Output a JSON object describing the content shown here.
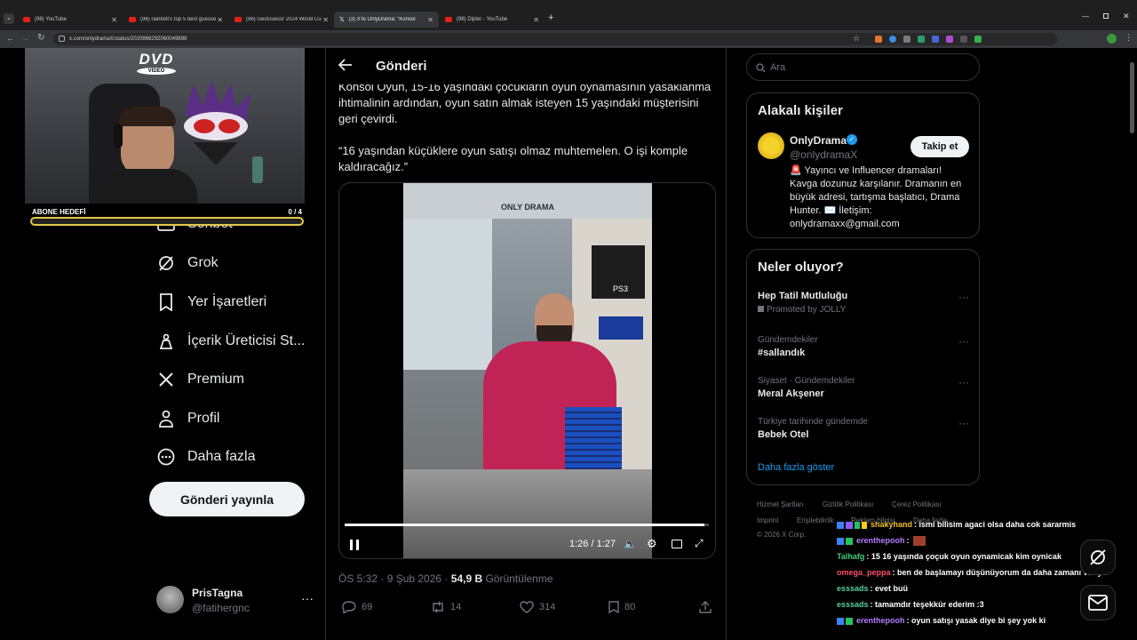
{
  "browser": {
    "tabs": [
      {
        "title": "(96) YouTube"
      },
      {
        "title": "(96) rainbolt's top 5 best guesse"
      },
      {
        "title": "(96) GeoGuessr 2024 World Cu"
      },
      {
        "title": "(3) X'te OnlyDrama: \"Konsol"
      },
      {
        "title": "(96) Dipter - YouTube"
      }
    ],
    "url": "x.com/onlydramaX/status/2020868292060049898"
  },
  "overlay": {
    "dvd_logo": "DVD",
    "dvd_sub": "VIDEO",
    "goal_label": "ABONE HEDEFİ",
    "goal_count": "0 / 4",
    "goal_progress": 0
  },
  "nav": {
    "items": [
      {
        "label": "Sohbet",
        "icon": "envelope-icon"
      },
      {
        "label": "Grok",
        "icon": "grok-icon"
      },
      {
        "label": "Yer İşaretleri",
        "icon": "bookmark-icon"
      },
      {
        "label": "İçerik Üreticisi St...",
        "icon": "creator-studio-icon"
      },
      {
        "label": "Premium",
        "icon": "x-logo-icon"
      },
      {
        "label": "Profil",
        "icon": "person-icon"
      },
      {
        "label": "Daha fazla",
        "icon": "more-circle-icon"
      }
    ],
    "post_button": "Gönderi yayınla",
    "account": {
      "name": "PrisTagna",
      "handle": "@fatihergnc"
    }
  },
  "post": {
    "header_title": "Gönderi",
    "text_lines": [
      "Konsol Oyun, 15-16 yaşındaki çocukların oyun oynamasının yasaklanma",
      "ihtimalinin ardından, oyun satın almak isteyen 15 yaşındaki müşterisini",
      "geri çevirdi."
    ],
    "quote_lines": [
      "“16 yaşından küçüklere oyun satışı olmaz muhtemelen. O işi komple",
      "kaldıracağız.”"
    ],
    "video": {
      "time": "1:26 / 1:27",
      "progress": 0.988,
      "sign": "ONLY DRAMA",
      "ps3_label": "PS3"
    },
    "timestamp": "ÖS 5:32 · 9 Şub 2026 ·",
    "views_count": "54,9 B",
    "views_label": "Görüntülenme",
    "stats": {
      "replies": "69",
      "reposts": "14",
      "likes": "314",
      "bookmarks": "80"
    }
  },
  "sidebar": {
    "search_placeholder": "Ara",
    "related": {
      "title": "Alakalı kişiler",
      "name": "OnlyDrama",
      "handle": "@onlydramaX",
      "follow": "Takip et",
      "bio": [
        "🚨 Yayıncı ve Influencer dramaları!",
        "Kavga dozunuz karşılanır. Dramanın en",
        "büyük adresi, tartışma başlatıcı, Drama",
        "Hunter. ✉️ İletişim:",
        "onlydramaxx@gmail.com"
      ]
    },
    "whats_happening": {
      "title": "Neler oluyor?",
      "trends": [
        {
          "context": "",
          "name": "Hep Tatil Mutluluğu",
          "promo": "Promoted by JOLLY"
        },
        {
          "context": "Gündemdekiler",
          "name": "#sallandık",
          "promo": ""
        },
        {
          "context": "Siyaset · Gündemdekiler",
          "name": "Meral Akşener",
          "promo": ""
        },
        {
          "context": "Türkiye tarihinde gündemde",
          "name": "Bebek Otel",
          "promo": ""
        }
      ],
      "show_more": "Daha fazla göster"
    },
    "footer": [
      "Hizmet Şartları",
      "Gizlilik Politikası",
      "Çerez Politikası",
      "Imprint",
      "Erişilebilirlik",
      "Reklam bilgisi",
      "Daha fazla ...",
      "© 2026 X Corp."
    ]
  },
  "chat": [
    {
      "user": "shakyhand",
      "color": "#f0c02a",
      "msg": ": ismi bilisim agaci olsa daha cok sararmis"
    },
    {
      "user": "erenthepooh",
      "color": "#b57cff",
      "msg": ":"
    },
    {
      "user": "Talhafg",
      "color": "#3fd17a",
      "msg": ": 15 16 yaşında çoçuk oyun oynamicak kim oynicak"
    },
    {
      "user": "omega_peppa",
      "color": "#ff4d6a",
      "msg": ": ben de başlamayı düşünüyorum da daha zamanı var ya"
    },
    {
      "user": "esssads",
      "color": "#5ad0a0",
      "msg": ": evet buü"
    },
    {
      "user": "esssads",
      "color": "#5ad0a0",
      "msg": ": tamamdır teşekkür ederim :3"
    },
    {
      "user": "erenthepooh",
      "color": "#b57cff",
      "msg": ": oyun satışı yasak diye bi şey yok ki"
    }
  ]
}
